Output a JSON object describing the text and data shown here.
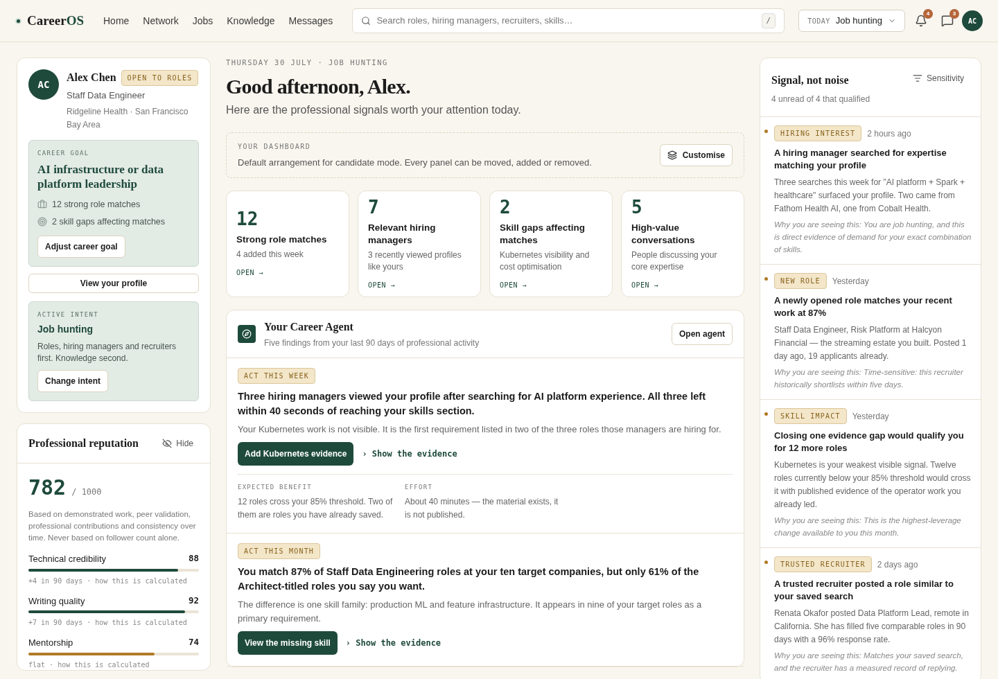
{
  "brand": {
    "name_a": "Career",
    "name_b": "OS"
  },
  "nav": [
    {
      "label": "Home"
    },
    {
      "label": "Network"
    },
    {
      "label": "Jobs"
    },
    {
      "label": "Knowledge"
    },
    {
      "label": "Messages"
    }
  ],
  "search": {
    "placeholder": "Search roles, hiring managers, recruiters, skills…",
    "shortcut": "/"
  },
  "intent_picker": {
    "label": "TODAY",
    "value": "Job hunting"
  },
  "notifications": {
    "count": "4"
  },
  "messages": {
    "count": "3"
  },
  "avatar": "AC",
  "profile": {
    "initials": "AC",
    "name": "Alex Chen",
    "badge": "OPEN TO ROLES",
    "title": "Staff Data Engineer",
    "location": "Ridgeline Health · San Francisco Bay Area",
    "goal": {
      "label": "CAREER GOAL",
      "title": "AI infrastructure or data platform leadership",
      "facts": [
        {
          "kind": "briefcase",
          "text": "12 strong role matches"
        },
        {
          "kind": "target",
          "text": "2 skill gaps affecting matches"
        }
      ],
      "button": "Adjust career goal"
    },
    "view_button": "View your profile",
    "intent": {
      "label": "ACTIVE INTENT",
      "title": "Job hunting",
      "text": "Roles, hiring managers and recruiters first. Knowledge second.",
      "button": "Change intent"
    }
  },
  "reputation": {
    "title": "Professional reputation",
    "hide": "Hide",
    "score": "782",
    "max": "/ 1000",
    "text": "Based on demonstrated work, peer validation, professional contributions and consistency over time. Never based on follower count alone.",
    "metrics": [
      {
        "name": "Technical credibility",
        "value": "88",
        "level": 0.88,
        "color": "#1e4a3c",
        "note": "+4 in 90 days · how this is calculated"
      },
      {
        "name": "Writing quality",
        "value": "92",
        "level": 0.92,
        "color": "#1e4a3c",
        "note": "+7 in 90 days · how this is calculated"
      },
      {
        "name": "Mentorship",
        "value": "74",
        "level": 0.74,
        "color": "#b07a26",
        "note": "flat · how this is calculated"
      }
    ]
  },
  "dateline": "THURSDAY 30 JULY · JOB HUNTING",
  "greeting": "Good afternoon, Alex.",
  "subtitle": "Here are the professional signals worth your attention today.",
  "dashboard": {
    "label": "YOUR DASHBOARD",
    "text": "Default arrangement for candidate mode. Every panel can be moved, added or removed.",
    "button": "Customise"
  },
  "stats": [
    {
      "value": "12",
      "title": "Strong role matches",
      "text": "4 added this week",
      "link": "OPEN →"
    },
    {
      "value": "7",
      "title": "Relevant hiring managers",
      "text": "3 recently viewed profiles like yours",
      "link": "OPEN →"
    },
    {
      "value": "2",
      "title": "Skill gaps affecting matches",
      "text": "Kubernetes visibility and cost optimisation",
      "link": "OPEN →"
    },
    {
      "value": "5",
      "title": "High-value conversations",
      "text": "People discussing your core expertise",
      "link": "OPEN →"
    }
  ],
  "agent": {
    "title": "Your Career Agent",
    "subtitle": "Five findings from your last 90 days of professional activity",
    "button": "Open agent",
    "findings": [
      {
        "tag": "ACT THIS WEEK",
        "title": "Three hiring managers viewed your profile after searching for AI platform experience. All three left within 40 seconds of reaching your skills section.",
        "text": "Your Kubernetes work is not visible. It is the first requirement listed in two of the three roles those managers are hiring for.",
        "action": "Add Kubernetes evidence",
        "link": "› Show the evidence",
        "details": [
          {
            "label": "EXPECTED BENEFIT",
            "text": "12 roles cross your 85% threshold. Two of them are roles you have already saved."
          },
          {
            "label": "EFFORT",
            "text": "About 40 minutes — the material exists, it is not published."
          }
        ]
      },
      {
        "tag": "ACT THIS MONTH",
        "title": "You match 87% of Staff Data Engineering roles at your ten target companies, but only 61% of the Architect-titled roles you say you want.",
        "text": "The difference is one skill family: production ML and feature infrastructure. It appears in nine of your target roles as a primary requirement.",
        "action": "View the missing skill",
        "link": "› Show the evidence"
      }
    ]
  },
  "signals": {
    "title": "Signal, not noise",
    "filter": "Sensitivity",
    "subtitle": "4 unread of 4 that qualified",
    "items": [
      {
        "unread": true,
        "tag": "HIRING INTEREST",
        "time": "2 hours ago",
        "title": "A hiring manager searched for expertise matching your profile",
        "text": "Three searches this week for \"AI platform + Spark + healthcare\" surfaced your profile. Two came from Fathom Health AI, one from Cobalt Health.",
        "why": "Why you are seeing this: You are job hunting, and this is direct evidence of demand for your exact combination of skills."
      },
      {
        "unread": true,
        "tag": "NEW ROLE",
        "time": "Yesterday",
        "title": "A newly opened role matches your recent work at 87%",
        "text": "Staff Data Engineer, Risk Platform at Halcyon Financial — the streaming estate you built. Posted 1 day ago, 19 applicants already.",
        "why": "Why you are seeing this: Time-sensitive: this recruiter historically shortlists within five days."
      },
      {
        "unread": true,
        "tag": "SKILL IMPACT",
        "time": "Yesterday",
        "title": "Closing one evidence gap would qualify you for 12 more roles",
        "text": "Kubernetes is your weakest visible signal. Twelve roles currently below your 85% threshold would cross it with published evidence of the operator work you already led.",
        "why": "Why you are seeing this: This is the highest-leverage change available to you this month."
      },
      {
        "unread": true,
        "tag": "TRUSTED RECRUITER",
        "time": "2 days ago",
        "title": "A trusted recruiter posted a role similar to your saved search",
        "text": "Renata Okafor posted Data Platform Lead, remote in California. She has filled five comparable roles in 90 days with a 96% response rate.",
        "why": "Why you are seeing this: Matches your saved search, and the recruiter has a measured record of replying."
      }
    ]
  }
}
